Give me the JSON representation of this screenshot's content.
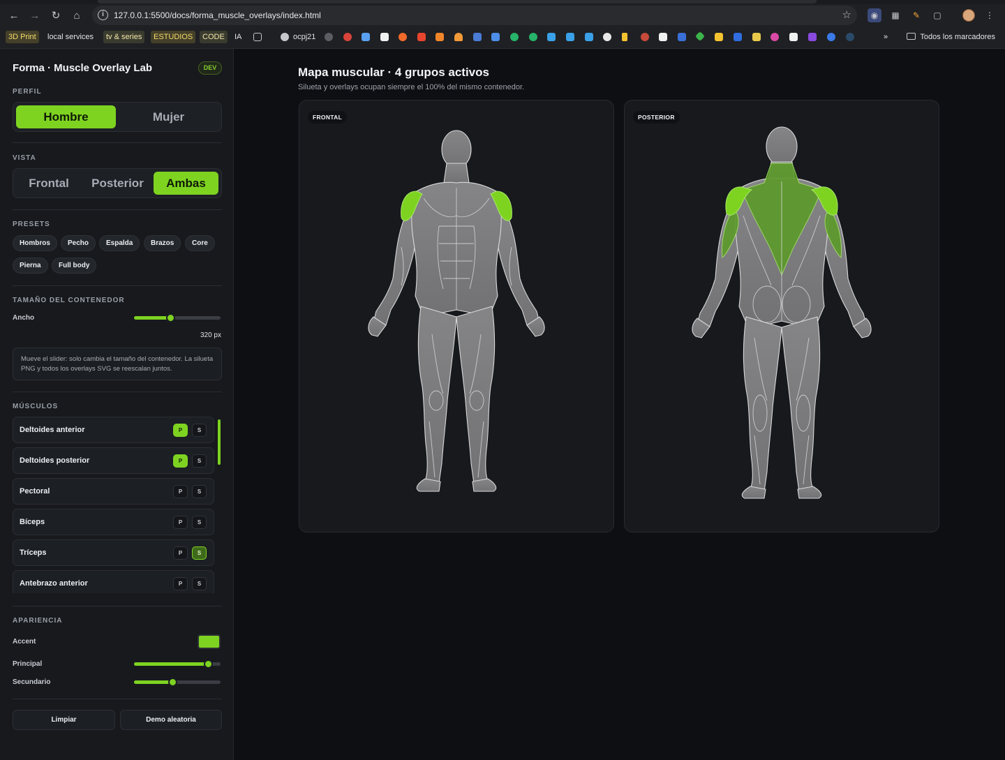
{
  "browser": {
    "url": "127.0.0.1:5500/docs/forma_muscle_overlays/index.html",
    "bookmarks": [
      "3D Print",
      "local services",
      "tv & series",
      "ESTUDIOS",
      "CODE",
      "IA",
      "ocpj21"
    ],
    "bookmarks_overflow": "»",
    "all_bookmarks": "Todos los marcadores"
  },
  "sidebar": {
    "title": "Forma · Muscle Overlay Lab",
    "badge": "DEV",
    "perfil": {
      "label": "PERFIL",
      "options": [
        "Hombre",
        "Mujer"
      ],
      "selected": "Hombre"
    },
    "vista": {
      "label": "VISTA",
      "options": [
        "Frontal",
        "Posterior",
        "Ambas"
      ],
      "selected": "Ambas"
    },
    "presets": {
      "label": "PRESETS",
      "items": [
        "Hombros",
        "Pecho",
        "Espalda",
        "Brazos",
        "Core",
        "Pierna",
        "Full body"
      ]
    },
    "container": {
      "label": "TAMAÑO DEL CONTENEDOR",
      "width_label": "Ancho",
      "width_fraction": 0.42,
      "width_value": "320 px",
      "note": "Mueve el slider: solo cambia el tamaño del contenedor. La silueta PNG y todos los overlays SVG se reescalan juntos."
    },
    "muscles": {
      "label": "MÚSCULOS",
      "primary_label": "P",
      "secondary_label": "S",
      "items": [
        {
          "name": "Deltoides anterior",
          "primary": true,
          "secondary": false
        },
        {
          "name": "Deltoides posterior",
          "primary": true,
          "secondary": false
        },
        {
          "name": "Pectoral",
          "primary": false,
          "secondary": false
        },
        {
          "name": "Bíceps",
          "primary": false,
          "secondary": false
        },
        {
          "name": "Tríceps",
          "primary": false,
          "secondary": true
        },
        {
          "name": "Antebrazo anterior",
          "primary": false,
          "secondary": false
        }
      ]
    },
    "appearance": {
      "label": "APARIENCIA",
      "accent_label": "Accent",
      "accent_color": "#7ed321",
      "primary_label": "Principal",
      "primary_fraction": 0.86,
      "secondary_label": "Secundario",
      "secondary_fraction": 0.45
    },
    "actions": {
      "clear": "Limpiar",
      "demo": "Demo aleatoria"
    }
  },
  "main": {
    "title": "Mapa muscular · 4 grupos activos",
    "subtitle": "Silueta y overlays ocupan siempre el 100% del mismo contenedor.",
    "front_label": "FRONTAL",
    "back_label": "POSTERIOR"
  },
  "colors": {
    "accent": "#7ed321",
    "secondary_overlay": "#5c9a2a",
    "silhouette": "#7b7b7d",
    "panel_bg": "#17191d",
    "page_bg": "#0d0f12"
  }
}
